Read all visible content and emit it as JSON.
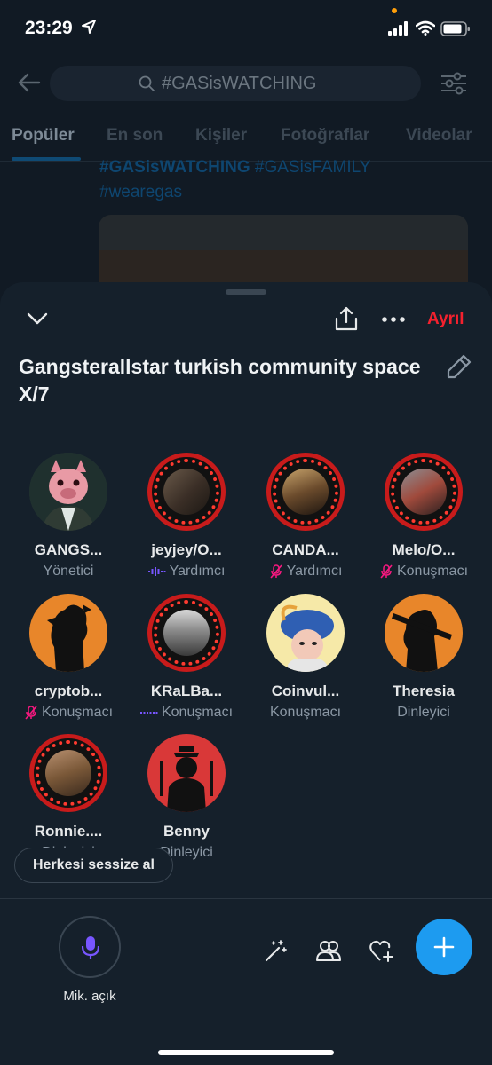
{
  "status_bar": {
    "time": "23:29"
  },
  "search_page": {
    "query": "#GASisWATCHING",
    "tabs": [
      {
        "label": "Popüler",
        "active": true
      },
      {
        "label": "En son"
      },
      {
        "label": "Kişiler"
      },
      {
        "label": "Fotoğraflar"
      },
      {
        "label": "Videolar"
      }
    ],
    "tweet_hashtags_line1_a": "#GASisWATCHING",
    "tweet_hashtags_line1_b": " #GASisFAMILY",
    "tweet_hashtags_line2": "#wearegas"
  },
  "space": {
    "leave_label": "Ayrıl",
    "title": "Gangsterallstar turkish community space X/7",
    "participants": [
      {
        "name": "GANGS...",
        "role": "Yönetici",
        "role_icon": "none"
      },
      {
        "name": "jeyjey/O...",
        "role": "Yardımcı",
        "role_icon": "speaking-waveform-icon"
      },
      {
        "name": "CANDA...",
        "role": "Yardımcı",
        "role_icon": "mic-muted-icon"
      },
      {
        "name": "Melo/O...",
        "role": "Konuşmacı",
        "role_icon": "mic-muted-icon"
      },
      {
        "name": "cryptob...",
        "role": "Konuşmacı",
        "role_icon": "mic-muted-icon"
      },
      {
        "name": "KRaLBa...",
        "role": "Konuşmacı",
        "role_icon": "speaking-waveform-icon"
      },
      {
        "name": "Coinvul...",
        "role": "Konuşmacı",
        "role_icon": "none"
      },
      {
        "name": "Theresia",
        "role": "Dinleyici",
        "role_icon": "none"
      },
      {
        "name": "Ronnie....",
        "role": "Dinleyici",
        "role_icon": "none"
      },
      {
        "name": "Benny",
        "role": "Dinleyici",
        "role_icon": "none"
      }
    ],
    "mute_all_label": "Herkesi sessize al",
    "mic_label": "Mik. açık"
  },
  "colors": {
    "accent": "#1d9bf0",
    "leave": "#f4212e",
    "mic_purple": "#7856ff",
    "muted_pink": "#f91880",
    "avatar_ring_red": "#c81b1b",
    "avatar_orange": "#e8862a"
  }
}
